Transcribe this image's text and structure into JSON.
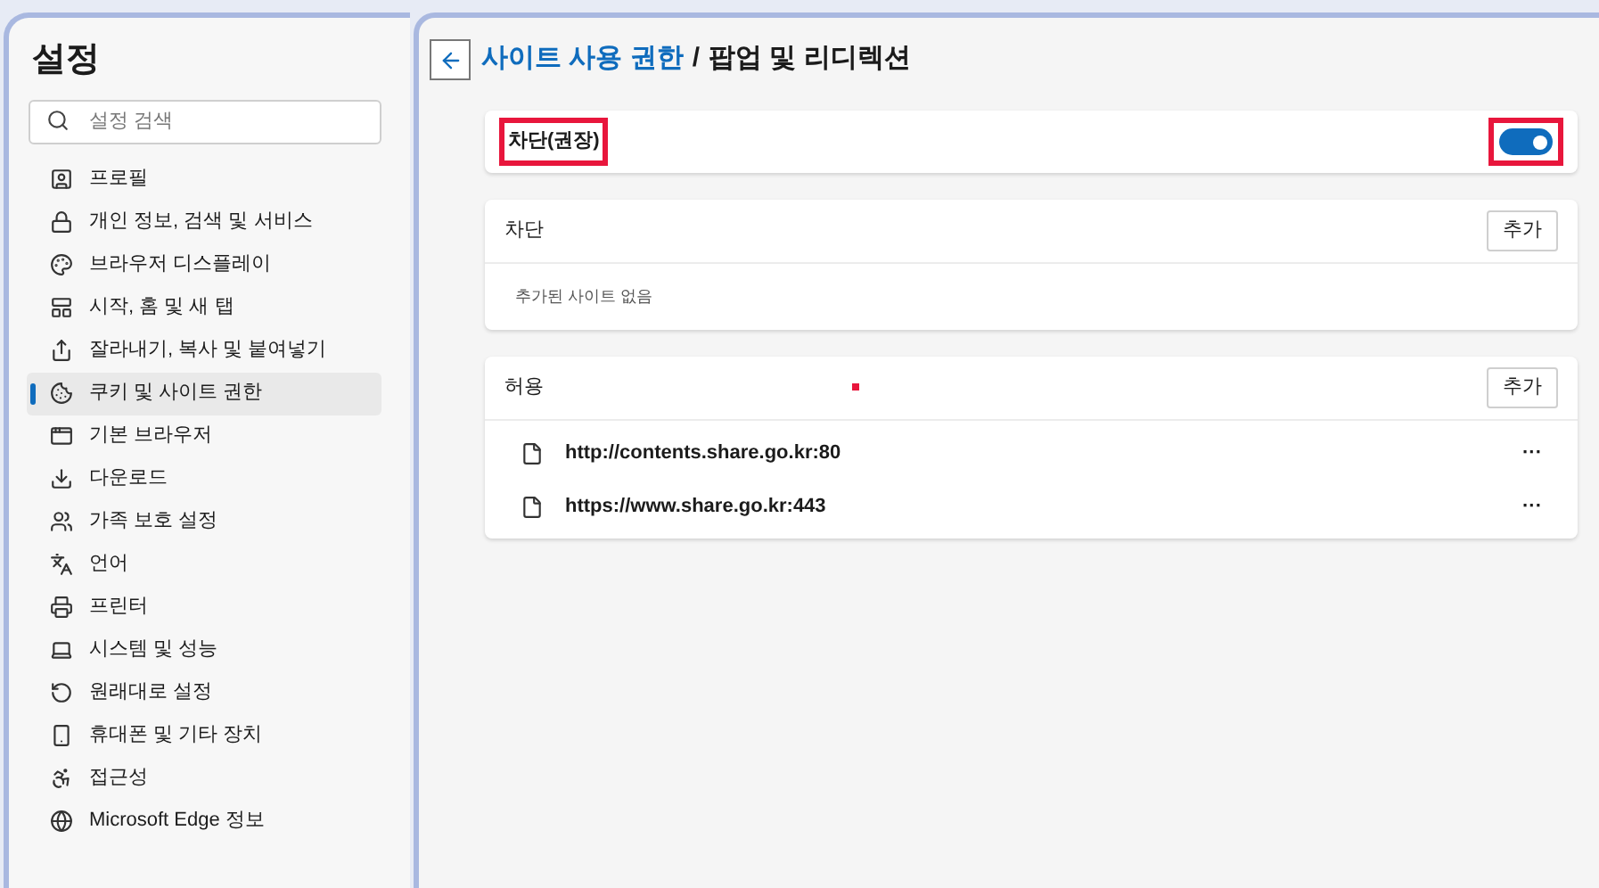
{
  "sidebar": {
    "title": "설정",
    "search": {
      "placeholder": "설정 검색"
    },
    "items": [
      {
        "label": "프로필",
        "selected": false
      },
      {
        "label": "개인 정보, 검색 및 서비스",
        "selected": false
      },
      {
        "label": "브라우저 디스플레이",
        "selected": false
      },
      {
        "label": "시작, 홈 및 새 탭",
        "selected": false
      },
      {
        "label": "잘라내기, 복사 및 붙여넣기",
        "selected": false
      },
      {
        "label": "쿠키 및 사이트 권한",
        "selected": true
      },
      {
        "label": "기본 브라우저",
        "selected": false
      },
      {
        "label": "다운로드",
        "selected": false
      },
      {
        "label": "가족 보호 설정",
        "selected": false
      },
      {
        "label": "언어",
        "selected": false
      },
      {
        "label": "프린터",
        "selected": false
      },
      {
        "label": "시스템 및 성능",
        "selected": false
      },
      {
        "label": "원래대로 설정",
        "selected": false
      },
      {
        "label": "휴대폰 및 기타 장치",
        "selected": false
      },
      {
        "label": "접근성",
        "selected": false
      },
      {
        "label": "Microsoft Edge 정보",
        "selected": false
      }
    ]
  },
  "header": {
    "parent": "사이트 사용 권한",
    "separator": "/",
    "title": "팝업 및 리디렉션"
  },
  "block_toggle": {
    "label": "차단(권장)",
    "on": true,
    "highlighted": true
  },
  "sections": [
    {
      "title": "차단",
      "button": "추가",
      "empty_text": "추가된 사이트 없음"
    },
    {
      "title": "허용",
      "button": "추가",
      "sites": [
        {
          "url": "http://contents.share.go.kr:80",
          "menu": "···"
        },
        {
          "url": "https://www.share.go.kr:443",
          "menu": "···"
        }
      ]
    }
  ]
}
